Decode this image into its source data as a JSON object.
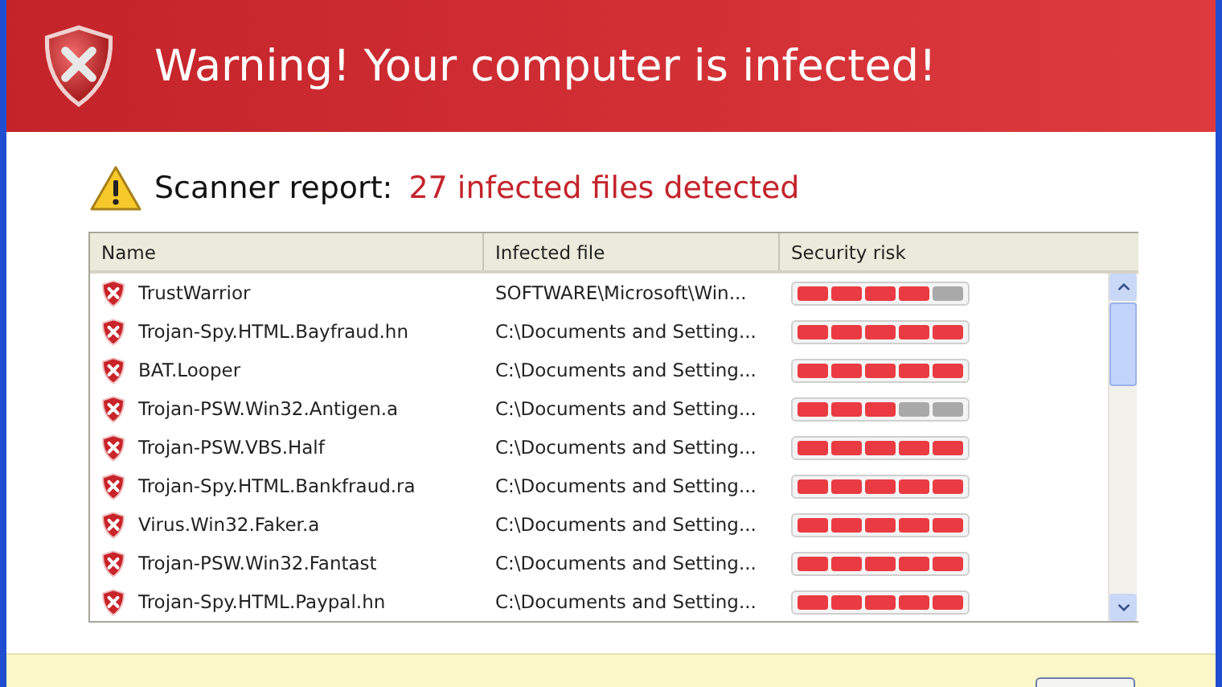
{
  "header": {
    "title": "Warning! Your computer is infected!"
  },
  "report": {
    "label": "Scanner report:",
    "result": "27 infected files detected"
  },
  "table": {
    "columns": [
      "Name",
      "Infected file",
      "Security risk"
    ],
    "rows": [
      {
        "name": "TrustWarrior",
        "file": "SOFTWARE\\Microsoft\\Win...",
        "level": 0.8
      },
      {
        "name": "Trojan-Spy.HTML.Bayfraud.hn",
        "file": "C:\\Documents and Setting...",
        "level": 1
      },
      {
        "name": "BAT.Looper",
        "file": "C:\\Documents and Setting...",
        "level": 1
      },
      {
        "name": "Trojan-PSW.Win32.Antigen.a",
        "file": "C:\\Documents and Setting...",
        "level": 0.6
      },
      {
        "name": "Trojan-PSW.VBS.Half",
        "file": "C:\\Documents and Setting...",
        "level": 1
      },
      {
        "name": "Trojan-Spy.HTML.Bankfraud.ra",
        "file": "C:\\Documents and Setting...",
        "level": 1
      },
      {
        "name": "Virus.Win32.Faker.a",
        "file": "C:\\Documents and Setting...",
        "level": 1
      },
      {
        "name": "Trojan-PSW.Win32.Fantast",
        "file": "C:\\Documents and Setting...",
        "level": 1
      },
      {
        "name": "Trojan-Spy.HTML.Paypal.hn",
        "file": "C:\\Documents and Setting...",
        "level": 1
      }
    ]
  }
}
